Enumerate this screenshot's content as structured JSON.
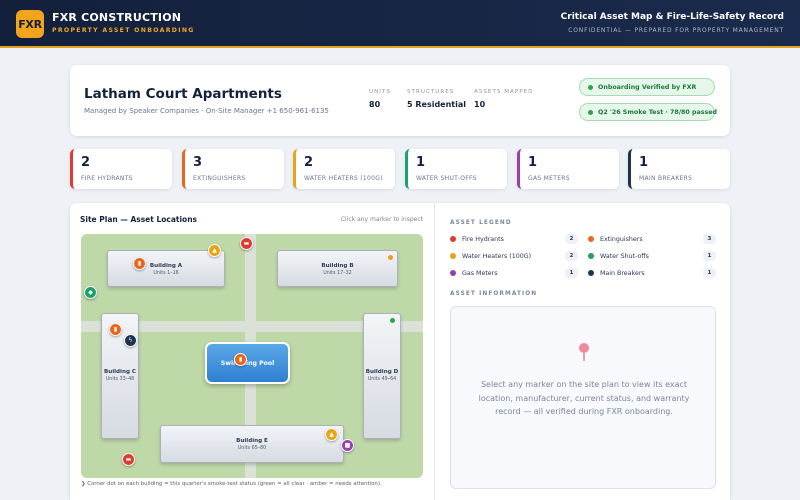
{
  "header": {
    "logo_text": "FXR",
    "brand_name": "FXR CONSTRUCTION",
    "brand_tagline": "PROPERTY ASSET ONBOARDING",
    "title": "Critical Asset Map & Fire-Life-Safety Record",
    "subtitle": "CONFIDENTIAL — PREPARED FOR PROPERTY MANAGEMENT"
  },
  "property": {
    "name": "Latham Court Apartments",
    "manager_line": "Managed by Speaker Companies · On-Site Manager +1 650-961-6135",
    "stats": [
      {
        "label": "UNITS",
        "value": "80"
      },
      {
        "label": "STRUCTURES",
        "value": "5 Residential"
      },
      {
        "label": "ASSETS MAPPED",
        "value": "10"
      }
    ],
    "badges": [
      "Onboarding Verified by FXR",
      "Q2 '26 Smoke Test · 78/80 passed"
    ]
  },
  "counts": [
    {
      "value": "2",
      "label": "FIRE HYDRANTS",
      "color": "#e03a2f"
    },
    {
      "value": "3",
      "label": "EXTINGUISHERS",
      "color": "#e8671f"
    },
    {
      "value": "2",
      "label": "WATER HEATERS (100G)",
      "color": "#e8a317"
    },
    {
      "value": "1",
      "label": "WATER SHUT-OFFS",
      "color": "#1ea06a"
    },
    {
      "value": "1",
      "label": "GAS METERS",
      "color": "#9b3fb0"
    },
    {
      "value": "1",
      "label": "MAIN BREAKERS",
      "color": "#1f3350"
    }
  ],
  "site_plan": {
    "title": "Site Plan — Asset Locations",
    "hint": "Click any marker to inspect",
    "pool_label": "Swimming Pool",
    "footnote": "❯ Corner dot on each building = this quarter's smoke-test status (green = all clear · amber = needs attention).",
    "buildings": [
      {
        "name": "Building A",
        "units": "Units 1–16",
        "status_color": "#e8a317"
      },
      {
        "name": "Building B",
        "units": "Units 17–32",
        "status_color": "#e8a317"
      },
      {
        "name": "Building C",
        "units": "Units 33–48",
        "status_color": "#28a745"
      },
      {
        "name": "Building D",
        "units": "Units 49–64",
        "status_color": "#28a745"
      },
      {
        "name": "Building E",
        "units": "Units 65–80",
        "status_color": "#28a745"
      }
    ],
    "markers": [
      {
        "type": "extinguisher",
        "icon": "extinguisher-icon",
        "glyph": "▮",
        "color": "#e8671f"
      },
      {
        "type": "water-heater",
        "icon": "flame-icon",
        "glyph": "▲",
        "color": "#e8a317"
      },
      {
        "type": "fire-hydrant",
        "icon": "hydrant-icon",
        "glyph": "▬",
        "color": "#e03a2f"
      },
      {
        "type": "water-shutoff",
        "icon": "valve-icon",
        "glyph": "◆",
        "color": "#1ea06a"
      },
      {
        "type": "extinguisher",
        "icon": "extinguisher-icon",
        "glyph": "▮",
        "color": "#e8671f"
      },
      {
        "type": "main-breaker",
        "icon": "bolt-icon",
        "glyph": "ϟ",
        "color": "#1f3350"
      },
      {
        "type": "extinguisher",
        "icon": "extinguisher-icon",
        "glyph": "▮",
        "color": "#e8671f"
      },
      {
        "type": "water-heater",
        "icon": "flame-icon",
        "glyph": "▲",
        "color": "#e8a317"
      },
      {
        "type": "gas-meter",
        "icon": "gas-meter-icon",
        "glyph": "■",
        "color": "#9b3fb0"
      },
      {
        "type": "fire-hydrant",
        "icon": "hydrant-icon",
        "glyph": "▬",
        "color": "#e03a2f"
      }
    ]
  },
  "legend": {
    "title": "ASSET LEGEND",
    "items": [
      {
        "label": "Fire Hydrants",
        "count": "2",
        "color": "#e03a2f"
      },
      {
        "label": "Extinguishers",
        "count": "3",
        "color": "#e8671f"
      },
      {
        "label": "Water Heaters (100G)",
        "count": "2",
        "color": "#e8a317"
      },
      {
        "label": "Water Shut-offs",
        "count": "1",
        "color": "#1ea06a"
      },
      {
        "label": "Gas Meters",
        "count": "1",
        "color": "#9b3fb0"
      },
      {
        "label": "Main Breakers",
        "count": "1",
        "color": "#1f3350"
      }
    ]
  },
  "info": {
    "title": "ASSET INFORMATION",
    "placeholder": "Select any marker on the site plan to view its exact location, manufacturer, current status, and warranty record — all verified during FXR onboarding."
  }
}
